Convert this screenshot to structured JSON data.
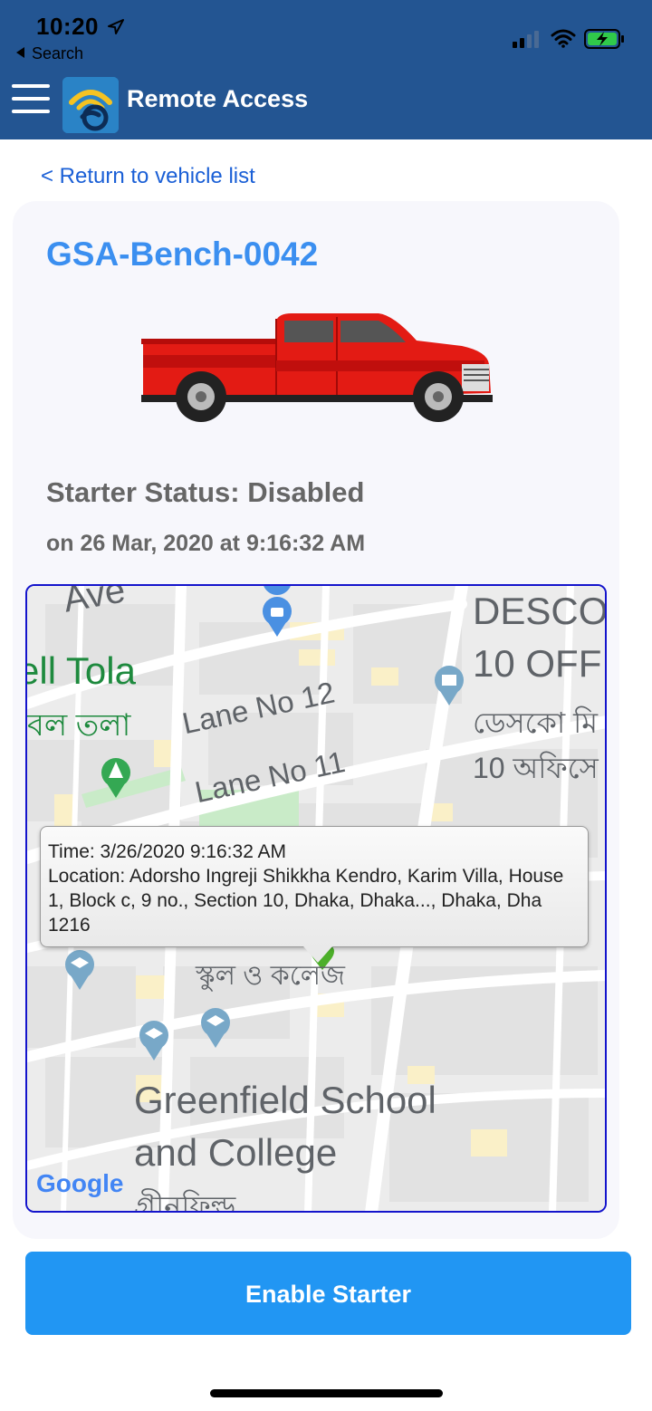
{
  "status_bar": {
    "time": "10:20",
    "back_label": "Search"
  },
  "header": {
    "title": "Remote Access",
    "brand_color": "#235592"
  },
  "return_link": "< Return to vehicle list",
  "vehicle": {
    "name": "GSA-Bench-0042",
    "image": "red-pickup-truck",
    "starter_status": "Starter Status: Disabled",
    "status_date": "on 26 Mar, 2020 at 9:16:32 AM"
  },
  "map": {
    "labels": {
      "ave": "Ave",
      "tola": "ell Tola",
      "tola_bn": "বল তলা",
      "desco1": "DESCO",
      "desco2": "10 OFF",
      "desco_bn1": "ডেসকো মি",
      "desco_bn2": "10 অফিসে",
      "lane12": "Lane No 12",
      "lane11": "Lane No 11",
      "school_bn": "স্কুল ও কলেজ",
      "greenfield1": "Greenfield School",
      "greenfield2": "and College",
      "greenfield_bn": "গ্রীনফিল্ড",
      "google": "Google"
    },
    "info_window": {
      "time": "Time: 3/26/2020 9:16:32 AM",
      "location": "Location: Adorsho Ingreji Shikkha Kendro, Karim Villa, House 1, Block c, 9 no., Section 10, Dhaka, Dhaka..., Dhaka, Dha 1216"
    }
  },
  "enable_button": "Enable Starter"
}
